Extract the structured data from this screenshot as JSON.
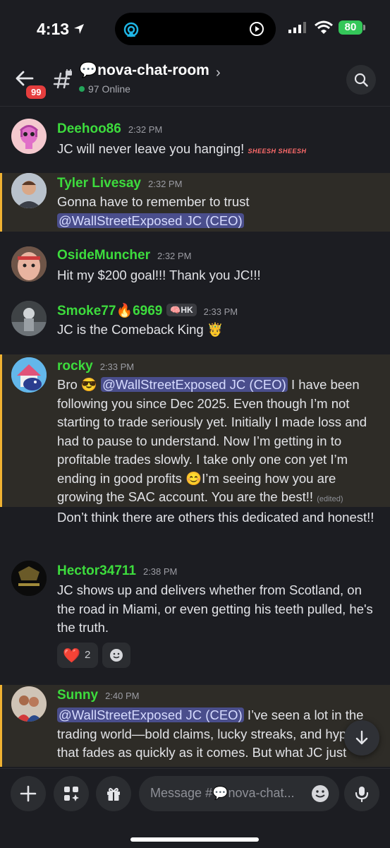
{
  "status_bar": {
    "time": "4:13",
    "battery": "80"
  },
  "header": {
    "unread_badge": "99",
    "channel_name": "💬nova-chat-room",
    "online_text": "97 Online"
  },
  "messages": [
    {
      "author": "Deehoo86",
      "time": "2:32 PM",
      "text": "JC will never leave you hanging!",
      "sticker_text": "SHEESH SHEESH"
    },
    {
      "author": "Tyler Livesay",
      "time": "2:32 PM",
      "text": "Gonna have to remember to trust",
      "mention": "@WallStreetExposed JC (CEO)"
    },
    {
      "author": "OsideMuncher",
      "time": "2:32 PM",
      "text": "Hit my $200 goal!!! Thank you JC!!!"
    },
    {
      "author": "Smoke77🔥6969",
      "tag": "🧠HK",
      "time": "2:33 PM",
      "text": "JC is the Comeback King 🤴"
    },
    {
      "author": "rocky",
      "time": "2:33 PM",
      "text_prefix": "Bro 😎",
      "mention": "@WallStreetExposed JC (CEO)",
      "text": " I have been following you since Dec 2025. Even though I’m not starting to trade seriously yet. Initially I made loss and had to pause to understand. Now I’m getting in to profitable trades slowly. I take only one con yet I’m ending in good profits 😊I’m seeing how you are growing the SAC account. You are the best!!",
      "edited": "(edited)",
      "followup": "Don’t think there are others this dedicated and honest!!"
    },
    {
      "author": "Hector34711",
      "time": "2:38 PM",
      "text": "JC shows up and delivers whether from Scotland,  on the road in Miami, or even getting his teeth pulled, he's the truth.",
      "reaction_emoji": "❤️",
      "reaction_count": "2"
    },
    {
      "author": "Sunny",
      "time": "2:40 PM",
      "mention": "@WallStreetExposed JC (CEO)",
      "text": " I’ve seen a lot in the trading world—bold claims, lucky streaks, and hype that fades as quickly as it comes. But what JC just"
    }
  ],
  "composer": {
    "placeholder": "Message #💬nova-chat..."
  },
  "colors": {
    "author": "#3ddc3d",
    "highlight_border": "#f0b232",
    "mention_bg": "#4a4e8c",
    "online": "#23a55a",
    "badge": "#e53e3e"
  }
}
